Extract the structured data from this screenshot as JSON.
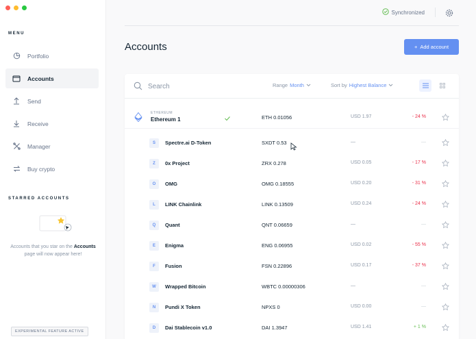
{
  "window": {
    "traffic_lights": {
      "close": "#ff5f57",
      "minimize": "#febc2e",
      "zoom": "#28c840"
    }
  },
  "colors": {
    "accent": "#6490f1",
    "negative": "#ea2e49",
    "positive": "#66be54",
    "text": "#142533",
    "muted": "#8a96a6"
  },
  "sidebar": {
    "menu_title": "MENU",
    "items": [
      {
        "label": "Portfolio",
        "icon": "portfolio-pie-icon",
        "active": false
      },
      {
        "label": "Accounts",
        "icon": "wallet-icon",
        "active": true
      },
      {
        "label": "Send",
        "icon": "arrow-up-icon",
        "active": false
      },
      {
        "label": "Receive",
        "icon": "arrow-down-icon",
        "active": false
      },
      {
        "label": "Manager",
        "icon": "tools-icon",
        "active": false
      },
      {
        "label": "Buy crypto",
        "icon": "exchange-icon",
        "active": false
      }
    ],
    "starred_title": "STARRED ACCOUNTS",
    "starred_text_before": "Accounts that you star on the",
    "starred_text_bold": "Accounts",
    "starred_text_after": "page will now appear here!",
    "experimental_badge": "EXPERIMENTAL FEATURE ACTIVE"
  },
  "topbar": {
    "sync_status": "Synchronized",
    "sync_icon": "check-circle-icon",
    "settings_icon": "gear-icon"
  },
  "main": {
    "title": "Accounts",
    "add_button_label": "Add account",
    "search_placeholder": "Search",
    "range_label": "Range",
    "range_value": "Month",
    "sort_label": "Sort by",
    "sort_value": "Highest Balance",
    "view_modes": [
      "list-view-icon",
      "grid-view-icon"
    ],
    "parent_account": {
      "chain": "ETHEREUM",
      "name": "Ethereum 1",
      "balance": "ETH 0.01056",
      "usd": "USD 1.97",
      "change": "- 24 %",
      "change_sign": "neg"
    },
    "tokens": [
      {
        "letter": "S",
        "name": "Spectre.ai D-Token",
        "balance": "SXDT 0.53",
        "usd": "—",
        "change": "—",
        "change_sign": "muted"
      },
      {
        "letter": "Z",
        "name": "0x Project",
        "balance": "ZRX 0.278",
        "usd": "USD 0.05",
        "change": "- 17 %",
        "change_sign": "neg"
      },
      {
        "letter": "O",
        "name": "OMG",
        "balance": "OMG 0.18555",
        "usd": "USD 0.20",
        "change": "- 31 %",
        "change_sign": "neg"
      },
      {
        "letter": "L",
        "name": "LINK Chainlink",
        "balance": "LINK 0.13509",
        "usd": "USD 0.24",
        "change": "- 24 %",
        "change_sign": "neg"
      },
      {
        "letter": "Q",
        "name": "Quant",
        "balance": "QNT 0.06659",
        "usd": "—",
        "change": "—",
        "change_sign": "muted"
      },
      {
        "letter": "E",
        "name": "Enigma",
        "balance": "ENG 0.06955",
        "usd": "USD 0.02",
        "change": "- 55 %",
        "change_sign": "neg"
      },
      {
        "letter": "F",
        "name": "Fusion",
        "balance": "FSN 0.22896",
        "usd": "USD 0.17",
        "change": "- 37 %",
        "change_sign": "neg"
      },
      {
        "letter": "W",
        "name": "Wrapped Bitcoin",
        "balance": "WBTC 0.00000306",
        "usd": "—",
        "change": "—",
        "change_sign": "muted"
      },
      {
        "letter": "N",
        "name": "Pundi X Token",
        "balance": "NPXS 0",
        "usd": "USD 0.00",
        "change": "—",
        "change_sign": "muted"
      },
      {
        "letter": "D",
        "name": "Dai Stablecoin v1.0",
        "balance": "DAI 1.3947",
        "usd": "USD 1.41",
        "change": "+ 1 %",
        "change_sign": "pos"
      }
    ]
  }
}
